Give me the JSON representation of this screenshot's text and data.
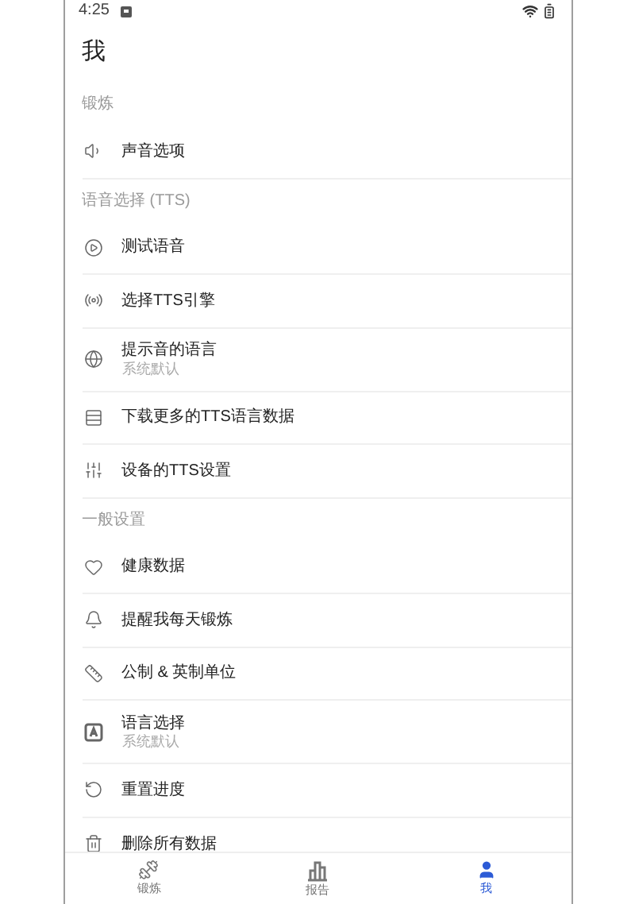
{
  "status_bar": {
    "time": "4:25"
  },
  "title": "我",
  "list": [
    {
      "kind": "section",
      "label": "锻炼"
    },
    {
      "kind": "item",
      "label": "声音选项"
    },
    {
      "kind": "section",
      "label": "语音选择 (TTS)"
    },
    {
      "kind": "item",
      "label": "测试语音"
    },
    {
      "kind": "item",
      "label": "选择TTS引擎"
    },
    {
      "kind": "item",
      "label": "提示音的语言",
      "subtitle": "系统默认"
    },
    {
      "kind": "item",
      "label": "下载更多的TTS语言数据"
    },
    {
      "kind": "item",
      "label": "设备的TTS设置"
    },
    {
      "kind": "section",
      "label": "一般设置"
    },
    {
      "kind": "item",
      "label": "健康数据"
    },
    {
      "kind": "item",
      "label": "提醒我每天锻炼"
    },
    {
      "kind": "item",
      "label": "公制 & 英制单位"
    },
    {
      "kind": "item",
      "label": "语言选择",
      "subtitle": "系统默认"
    },
    {
      "kind": "item",
      "label": "重置进度"
    },
    {
      "kind": "item",
      "label": "删除所有数据"
    }
  ],
  "nav": [
    {
      "label": "锻炼",
      "selected": false
    },
    {
      "label": "报告",
      "selected": false
    },
    {
      "label": "我",
      "selected": true
    }
  ]
}
